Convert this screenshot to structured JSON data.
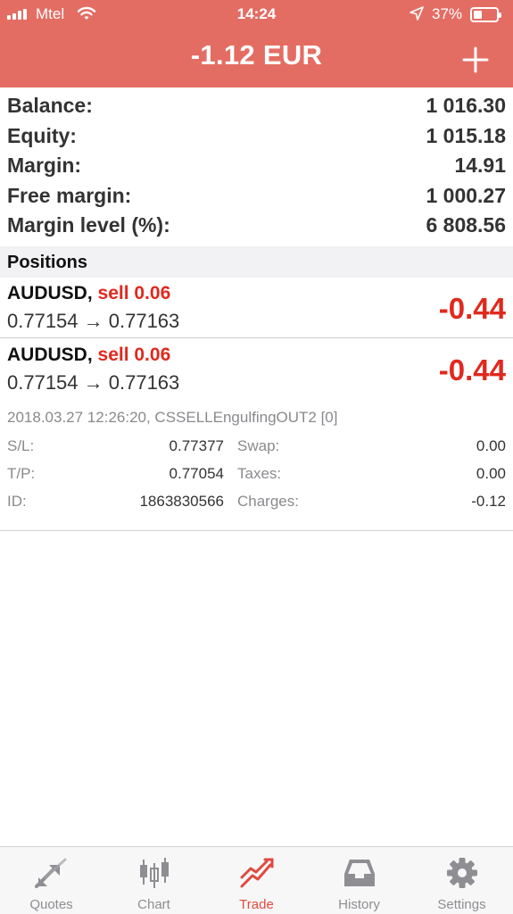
{
  "status_bar": {
    "carrier": "Mtel",
    "time": "14:24",
    "battery": "37%",
    "battery_level": 0.37
  },
  "header": {
    "title": "-1.12 EUR",
    "icons": [
      "plus-icon"
    ]
  },
  "colors": {
    "header_bg": "#e46d63",
    "negative": "#e0291e",
    "tab_active": "#e0493e",
    "tab_inactive": "#8e8e93"
  },
  "account": {
    "balance_label": "Balance:",
    "balance_value": "1 016.30",
    "equity_label": "Equity:",
    "equity_value": "1 015.18",
    "margin_label": "Margin:",
    "margin_value": "14.91",
    "free_margin_label": "Free margin:",
    "free_margin_value": "1 000.27",
    "margin_level_label": "Margin level (%):",
    "margin_level_value": "6 808.56"
  },
  "positions_header": "Positions",
  "positions": [
    {
      "symbol": "AUDUSD,",
      "side": "sell 0.06",
      "prices": "0.77154 → 0.77163",
      "profit": "-0.44"
    },
    {
      "symbol": "AUDUSD,",
      "side": "sell 0.06",
      "prices": "0.77154 → 0.77163",
      "profit": "-0.44"
    }
  ],
  "details": {
    "comment": "2018.03.27 12:26:20, CSSELLEngulfingOUT2 [0]",
    "sl_label": "S/L:",
    "sl_value": "0.77377",
    "swap_label": "Swap:",
    "swap_value": "0.00",
    "tp_label": "T/P:",
    "tp_value": "0.77054",
    "taxes_label": "Taxes:",
    "taxes_value": "0.00",
    "id_label": "ID:",
    "id_value": "1863830566",
    "charges_label": "Charges:",
    "charges_value": "-0.12"
  },
  "tabs": [
    {
      "label": "Quotes",
      "icon": "quotes-arrows-icon"
    },
    {
      "label": "Chart",
      "icon": "candlestick-chart-icon"
    },
    {
      "label": "Trade",
      "icon": "trade-trend-icon",
      "active": true
    },
    {
      "label": "History",
      "icon": "inbox-tray-icon"
    },
    {
      "label": "Settings",
      "icon": "gear-icon"
    }
  ]
}
